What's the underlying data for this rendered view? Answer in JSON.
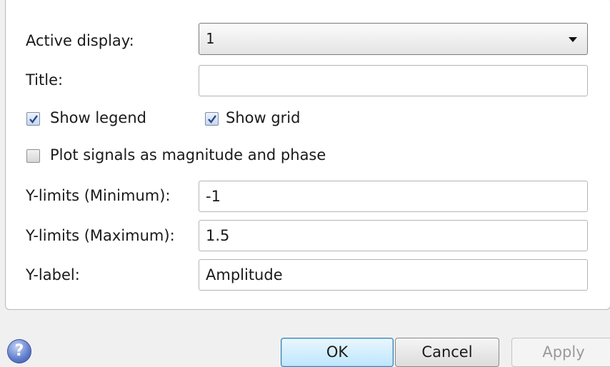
{
  "fields": {
    "active_display_label": "Active display:",
    "active_display_value": "1",
    "title_label": "Title:",
    "title_value": "",
    "show_legend_label": "Show legend",
    "show_legend_checked": true,
    "show_grid_label": "Show grid",
    "show_grid_checked": true,
    "mag_phase_label": "Plot signals as magnitude and phase",
    "mag_phase_checked": false,
    "ymin_label": "Y-limits (Minimum):",
    "ymin_value": "-1",
    "ymax_label": "Y-limits (Maximum):",
    "ymax_value": "1.5",
    "ylabel_label": "Y-label:",
    "ylabel_value": "Amplitude"
  },
  "buttons": {
    "help_glyph": "?",
    "ok": "OK",
    "cancel": "Cancel",
    "apply": "Apply"
  },
  "icons": [
    "help-icon",
    "dropdown-arrow-icon",
    "checkmark-icon"
  ],
  "colors": {
    "ok_border": "#3c7fb1",
    "help_blue": "#5f7dcb"
  }
}
